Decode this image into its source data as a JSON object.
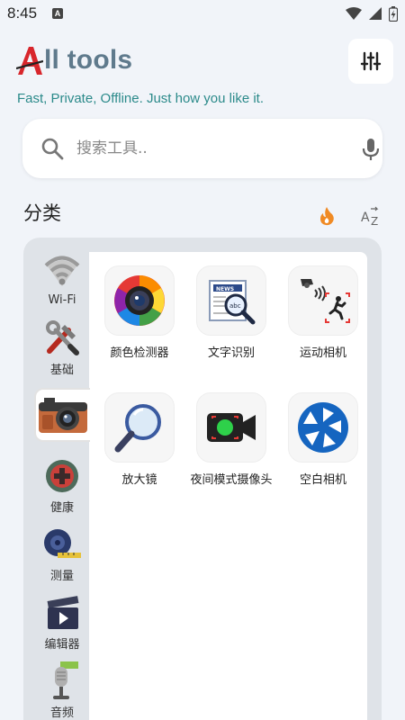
{
  "status": {
    "time": "8:45",
    "app_badge": "A"
  },
  "header": {
    "logo_letter": "A",
    "title": "ll tools",
    "tagline": "Fast, Private, Offline. Just how you like it."
  },
  "search": {
    "placeholder": "搜索工具.."
  },
  "categories_title": "分类",
  "sort": {
    "popular_icon": "fire-icon",
    "alpha_icon": "az-sort-icon",
    "alpha_label": "AZ"
  },
  "sidebar": {
    "items": [
      {
        "label": "Wi-Fi",
        "icon": "wifi-icon"
      },
      {
        "label": "基础",
        "icon": "tools-icon"
      },
      {
        "label": "",
        "icon": "camera-icon",
        "active": true
      },
      {
        "label": "健康",
        "icon": "health-icon"
      },
      {
        "label": "测量",
        "icon": "tape-measure-icon"
      },
      {
        "label": "编辑器",
        "icon": "video-editor-icon"
      },
      {
        "label": "音频",
        "icon": "microphone-icon"
      }
    ]
  },
  "tools": [
    {
      "label": "颜色检测器",
      "icon": "color-wheel-lens-icon"
    },
    {
      "label": "文字识别",
      "icon": "newspaper-magnifier-icon"
    },
    {
      "label": "运动相机",
      "icon": "motion-camera-icon"
    },
    {
      "label": "放大镜",
      "icon": "magnifier-icon"
    },
    {
      "label": "夜间模式摄像头",
      "icon": "night-camera-icon"
    },
    {
      "label": "空白相机",
      "icon": "shutter-icon"
    }
  ],
  "colors": {
    "background": "#f1f4f9",
    "logo_red": "#d8262c",
    "title_gray": "#5f7a8c",
    "tagline_teal": "#2b8a8a",
    "fire_orange": "#f08a24"
  }
}
